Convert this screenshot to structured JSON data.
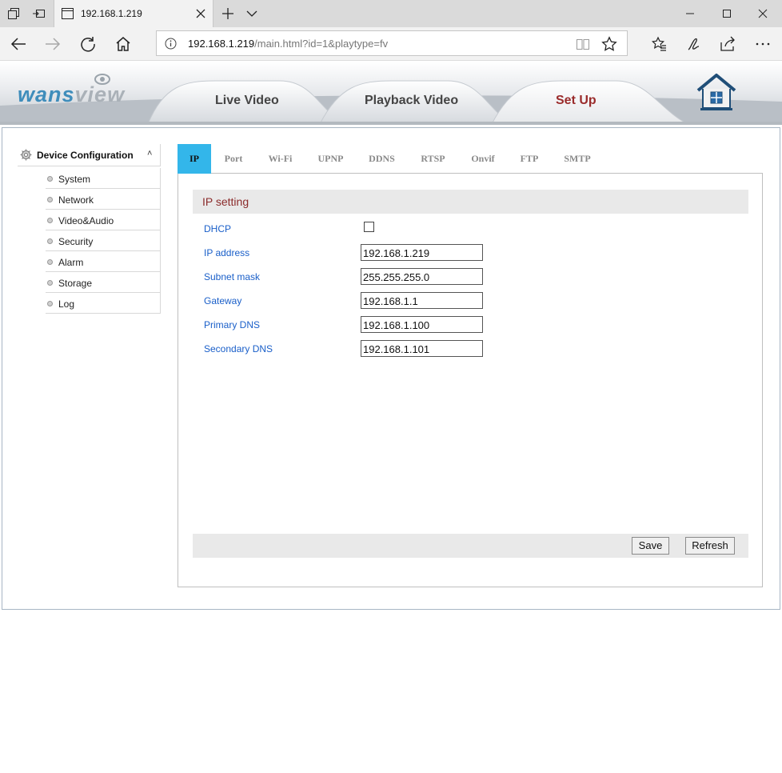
{
  "browser": {
    "tab_title": "192.168.1.219",
    "url_host": "192.168.1.219",
    "url_path": "/main.html?id=1&playtype=fv"
  },
  "header": {
    "logo_main": "wans",
    "logo_dim": "view",
    "nav_tabs": [
      {
        "label": "Live Video"
      },
      {
        "label": "Playback Video"
      },
      {
        "label": "Set Up",
        "active": true
      }
    ]
  },
  "sidebar": {
    "title": "Device Configuration",
    "caret": "˄",
    "items": [
      {
        "label": "System"
      },
      {
        "label": "Network"
      },
      {
        "label": "Video&Audio"
      },
      {
        "label": "Security"
      },
      {
        "label": "Alarm"
      },
      {
        "label": "Storage"
      },
      {
        "label": "Log"
      }
    ]
  },
  "subtabs": [
    {
      "label": "IP",
      "active": true
    },
    {
      "label": "Port"
    },
    {
      "label": "Wi-Fi"
    },
    {
      "label": "UPNP"
    },
    {
      "label": "DDNS"
    },
    {
      "label": "RTSP"
    },
    {
      "label": "Onvif"
    },
    {
      "label": "FTP"
    },
    {
      "label": "SMTP"
    }
  ],
  "ip_setting": {
    "title": "IP setting",
    "dhcp_label": "DHCP",
    "dhcp_checked": false,
    "fields": [
      {
        "label": "IP address",
        "value": "192.168.1.219"
      },
      {
        "label": "Subnet mask",
        "value": "255.255.255.0"
      },
      {
        "label": "Gateway",
        "value": "192.168.1.1"
      },
      {
        "label": "Primary DNS",
        "value": "192.168.1.100"
      },
      {
        "label": "Secondary DNS",
        "value": "192.168.1.101"
      }
    ]
  },
  "actions": {
    "save_label": "Save",
    "refresh_label": "Refresh"
  },
  "colors": {
    "active_subtab": "#33b6ea",
    "field_label": "#1a5fc9",
    "section_title": "#8b2b2b",
    "active_nav": "#9a2b2b",
    "logo": "#3f8dbb"
  }
}
